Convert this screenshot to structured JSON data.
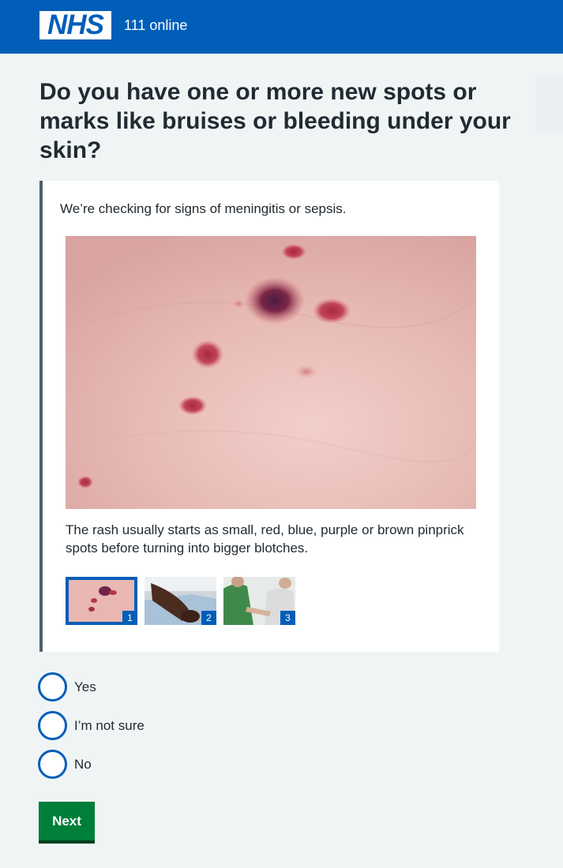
{
  "header": {
    "logo_text": "NHS",
    "service_name": "111 online",
    "background_color": "#005eb8"
  },
  "question": {
    "title": "Do you have one or more new spots or marks like bruises or bleeding under your skin?"
  },
  "inset": {
    "intro": "We’re checking for signs of meningitis or sepsis.",
    "caption": "The rash usually starts as small, red, blue, purple or brown pinprick spots before turning into bigger blotches.",
    "thumbnails": [
      {
        "number": "1",
        "selected": true
      },
      {
        "number": "2",
        "selected": false
      },
      {
        "number": "3",
        "selected": false
      }
    ]
  },
  "options": [
    {
      "label": "Yes"
    },
    {
      "label": "I’m not sure"
    },
    {
      "label": "No"
    }
  ],
  "actions": {
    "next_label": "Next",
    "next_color": "#007f3b"
  }
}
